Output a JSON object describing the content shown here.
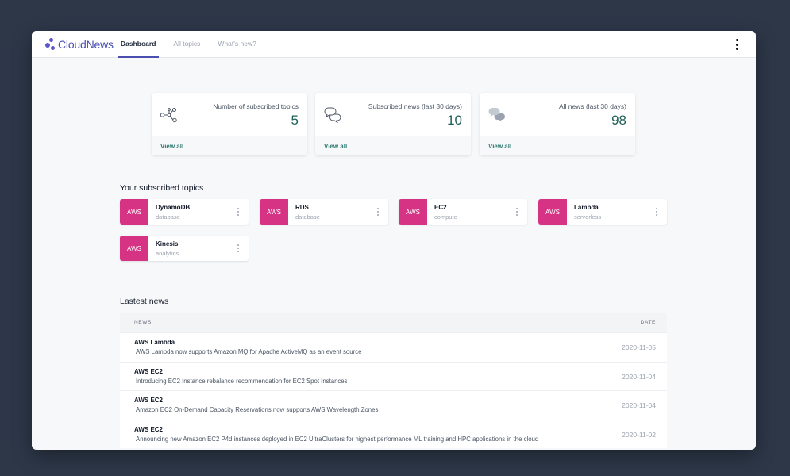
{
  "app": {
    "name": "CloudNews"
  },
  "nav": {
    "items": [
      {
        "label": "Dashboard",
        "active": true
      },
      {
        "label": "All topics",
        "active": false
      },
      {
        "label": "What's new?",
        "active": false
      }
    ]
  },
  "stats": [
    {
      "label": "Number of subscribed topics",
      "value": "5",
      "link": "View all",
      "icon": "network-nodes-icon"
    },
    {
      "label": "Subscribed news (last 30 days)",
      "value": "10",
      "link": "View all",
      "icon": "chat-bubbles-outline-icon"
    },
    {
      "label": "All news (last 30 days)",
      "value": "98",
      "link": "View all",
      "icon": "chat-bubbles-filled-icon"
    }
  ],
  "topics": {
    "title": "Your subscribed topics",
    "items": [
      {
        "badge": "AWS",
        "name": "DynamoDB",
        "category": "database"
      },
      {
        "badge": "AWS",
        "name": "RDS",
        "category": "database"
      },
      {
        "badge": "AWS",
        "name": "EC2",
        "category": "compute"
      },
      {
        "badge": "AWS",
        "name": "Lambda",
        "category": "serverless"
      },
      {
        "badge": "AWS",
        "name": "Kinesis",
        "category": "analytics"
      }
    ]
  },
  "news": {
    "title": "Lastest news",
    "columns": {
      "news": "NEWS",
      "date": "DATE"
    },
    "rows": [
      {
        "title": "AWS Lambda",
        "description": "AWS Lambda now supports Amazon MQ for Apache ActiveMQ as an event source",
        "date": "2020-11-05"
      },
      {
        "title": "AWS EC2",
        "description": "Introducing EC2 Instance rebalance recommendation for EC2 Spot Instances",
        "date": "2020-11-04"
      },
      {
        "title": "AWS EC2",
        "description": "Amazon EC2 On-Demand Capacity Reservations now supports AWS Wavelength Zones",
        "date": "2020-11-04"
      },
      {
        "title": "AWS EC2",
        "description": "Announcing new Amazon EC2 P4d instances deployed in EC2 UltraClusters for highest performance ML training and HPC applications in the cloud",
        "date": "2020-11-02"
      }
    ]
  },
  "colors": {
    "brand": "#4a4fb0",
    "badge": "#d63384",
    "accent": "#1f5f58",
    "background": "#2d3748"
  }
}
